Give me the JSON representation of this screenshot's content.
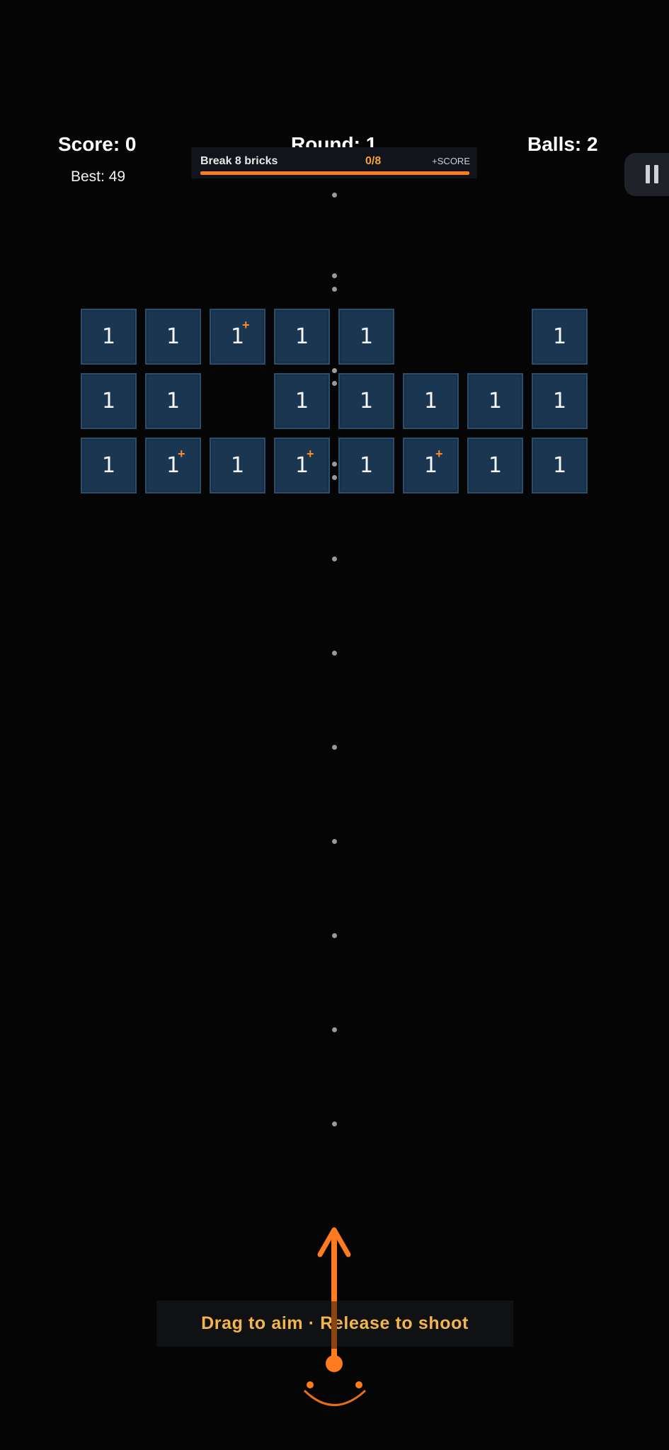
{
  "hud": {
    "score": "Score: 0",
    "round": "Round: 1",
    "balls": "Balls: 2",
    "best": "Best: 49"
  },
  "mission": {
    "title": "Break 8 bricks",
    "progress": "0/8",
    "reward": "+SCORE",
    "progress_fraction": 0
  },
  "pause_icon": "pause-icon",
  "bricks": {
    "rows": [
      [
        "1",
        "1",
        "1+",
        "1",
        "1",
        "",
        "",
        "1"
      ],
      [
        "1",
        "1",
        "",
        "1",
        "1",
        "1",
        "1",
        "1"
      ],
      [
        "1",
        "1+",
        "1",
        "1+",
        "1",
        "1+",
        "1",
        "1"
      ]
    ]
  },
  "hint": "Drag to aim · Release to shoot",
  "colors": {
    "accent": "#ff7b20",
    "brick": "#1b3650",
    "hint_text": "#f4b54a",
    "background": "#050505"
  }
}
